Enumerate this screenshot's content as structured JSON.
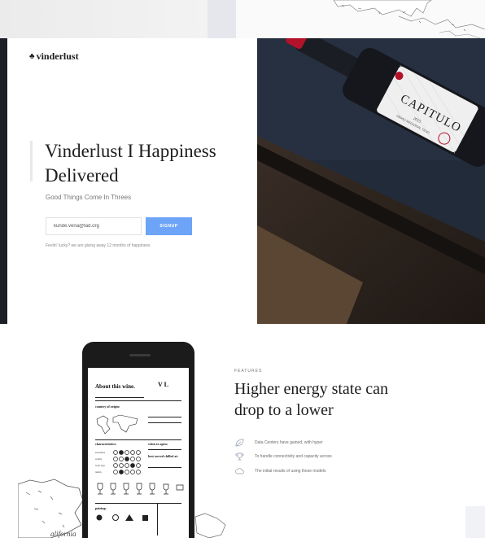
{
  "brand": {
    "name": "vinderlust"
  },
  "hero": {
    "title": "Vinderlust I Happiness Delivered",
    "subtitle": "Good Things Come In Threes",
    "email_value": "kunde.vena@tad.org",
    "signup_label": "SIGNUP",
    "note": "Feelin' lucky? we are giving away 12 months of happiness"
  },
  "bottle": {
    "brand": "CAPITULO",
    "year": "2015",
    "region": "VINHO REGIONAL TEJO"
  },
  "phone_screen": {
    "title": "About this wine.",
    "logo": "V L",
    "country_heading": "country of origin:",
    "characteristics_heading": "characteristics:",
    "when_heading": "when to open:",
    "serve_heading": "best served chilled at:",
    "traits": [
      "sweetness",
      "acidity",
      "body type",
      "tannin"
    ],
    "pairing_heading": "pairing:"
  },
  "features": {
    "label": "FEATURES",
    "title": "Higher energy state can drop to a lower",
    "items": [
      {
        "icon": "leaf-icon",
        "text": "Data Centers have gained, with hyper"
      },
      {
        "icon": "trophy-icon",
        "text": "To handle connectivity and capacity across"
      },
      {
        "icon": "cloud-icon",
        "text": "The initial results of using these models"
      }
    ]
  },
  "colors": {
    "accent": "#6da4f7",
    "dark_rail": "#1d1f27",
    "text": "#1d1d1d"
  }
}
